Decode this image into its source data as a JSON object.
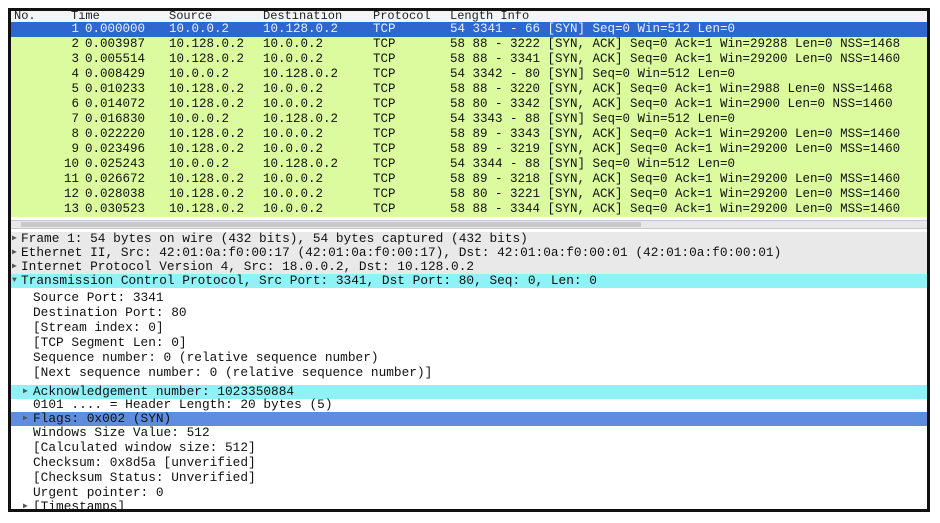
{
  "columns": {
    "no": "No.",
    "time": "Time",
    "source": "Source",
    "destination": "Destination",
    "protocol": "Protocol",
    "length_info": "Length Info"
  },
  "packets": [
    {
      "no": "1",
      "time": "0.000000",
      "src": "10.0.0.2",
      "dst": "10.128.0.2",
      "proto": "TCP",
      "info": "54 3341 - 66 [SYN] Seq=0 Win=512 Len=0"
    },
    {
      "no": "2",
      "time": "0.003987",
      "src": "10.128.0.2",
      "dst": "10.0.0.2",
      "proto": "TCP",
      "info": "58 88 - 3222 [SYN, ACK] Seq=0 Ack=1 Win=29288 Len=0 NSS=1468"
    },
    {
      "no": "3",
      "time": "0.005514",
      "src": "10.128.0.2",
      "dst": "10.0.0.2",
      "proto": "TCP",
      "info": "58 88 - 3341 [SYN, ACK] Seq=0 Ack=1 Win=29200 Len=0 NSS=1460"
    },
    {
      "no": "4",
      "time": "0.008429",
      "src": "10.0.0.2",
      "dst": "10.128.0.2",
      "proto": "TCP",
      "info": "54 3342 - 80 [SYN] Seq=0 Win=512 Len=0"
    },
    {
      "no": "5",
      "time": "0.010233",
      "src": "10.128.0.2",
      "dst": "10.0.0.2",
      "proto": "TCP",
      "info": "58 88 - 3220 [SYN, ACK] Seq=0 Ack=1 Win=2988 Len=0 NSS=1468"
    },
    {
      "no": "6",
      "time": "0.014072",
      "src": "10.128.0.2",
      "dst": "10.0.0.2",
      "proto": "TCP",
      "info": "58 80 - 3342 [SYN, ACK] Seq=0 Ack=1 Win=2900 Len=0 NSS=1460"
    },
    {
      "no": "7",
      "time": "0.016830",
      "src": "10.0.0.2",
      "dst": "10.128.0.2",
      "proto": "TCP",
      "info": "54 3343 - 88 [SYN] Seq=0 Win=512 Len=0"
    },
    {
      "no": "8",
      "time": "0.022220",
      "src": "10.128.0.2",
      "dst": "10.0.0.2",
      "proto": "TCP",
      "info": "58 89 - 3343 [SYN, ACK] Seq=0 Ack=1 Win=29200 Len=0 MSS=1460"
    },
    {
      "no": "9",
      "time": "0.023496",
      "src": "10.128.0.2",
      "dst": "10.0.0.2",
      "proto": "TCP",
      "info": "58 89 - 3219 [SYN, ACK] Seq=0 Ack=1 Win=29200 Len=0 MSS=1460"
    },
    {
      "no": "10",
      "time": "0.025243",
      "src": "10.0.0.2",
      "dst": "10.128.0.2",
      "proto": "TCP",
      "info": "54 3344 - 88 [SYN] Seq=0 Win=512 Len=0"
    },
    {
      "no": "11",
      "time": "0.026672",
      "src": "10.128.0.2",
      "dst": "10.0.0.2",
      "proto": "TCP",
      "info": "58 89 - 3218 [SYN, ACK] Seq=0 Ack=1 Win=29200 Len=0 MSS=1460"
    },
    {
      "no": "12",
      "time": "0.028038",
      "src": "10.128.0.2",
      "dst": "10.0.0.2",
      "proto": "TCP",
      "info": "58 80 - 3221 [SYN, ACK] Seq=0 Ack=1 Win=29200 Len=0 MSS=1460"
    },
    {
      "no": "13",
      "time": "0.030523",
      "src": "10.128.0.2",
      "dst": "10.0.0.2",
      "proto": "TCP",
      "info": "58 88 - 3344 [SYN, ACK] Seq=0 Ack=1 Win=29200 Len=0 MSS=1460"
    }
  ],
  "details": {
    "frame": "Frame 1: 54 bytes on wire (432 bits), 54 bytes captured (432 bits)",
    "ethernet": "Ethernet II, Src: 42:01:0a:f0:00:17 (42:01:0a:f0:00:17), Dst: 42:01:0a:f0:00:01 (42:01:0a:f0:00:01)",
    "ip": "Internet Protocol Version 4, Src: 18.0.0.2, Dst: 10.128.0.2",
    "tcp": "Transmission Control Protocol, Src Port: 3341, Dst Port: 80, Seq: 0, Len: 0",
    "fields": {
      "src_port": "Source Port: 3341",
      "dst_port": "Destination Port: 80",
      "stream_index": "[Stream index: 0]",
      "seg_len": "[TCP Segment Len: 0]",
      "seq": "Sequence number: 0 (relative sequence number)",
      "next_seq": "[Next sequence number: 0 (relative sequence number)]",
      "ack": "Acknowledgement number: 1023350884",
      "header_len": "0101 .... = Header Length: 20 bytes (5)",
      "flags": "Flags: 0x002 (SYN)",
      "window": "Windows Size Value: 512",
      "calc_window": "[Calculated window size: 512]",
      "checksum": "Checksum: 0x8d5a [unverified]",
      "checksum_status": "[Checksum Status: Unverified]",
      "urgent": "Urgent pointer: 0",
      "timestamps": "[Timestamps]"
    }
  },
  "icons": {
    "expand": "right-triangle-icon"
  },
  "colors": {
    "row_bg": "#dcfb9f",
    "selected_row": "#2f66d0",
    "tcp_highlight": "#8ff2f7",
    "flags_highlight": "#5e8ddf"
  }
}
